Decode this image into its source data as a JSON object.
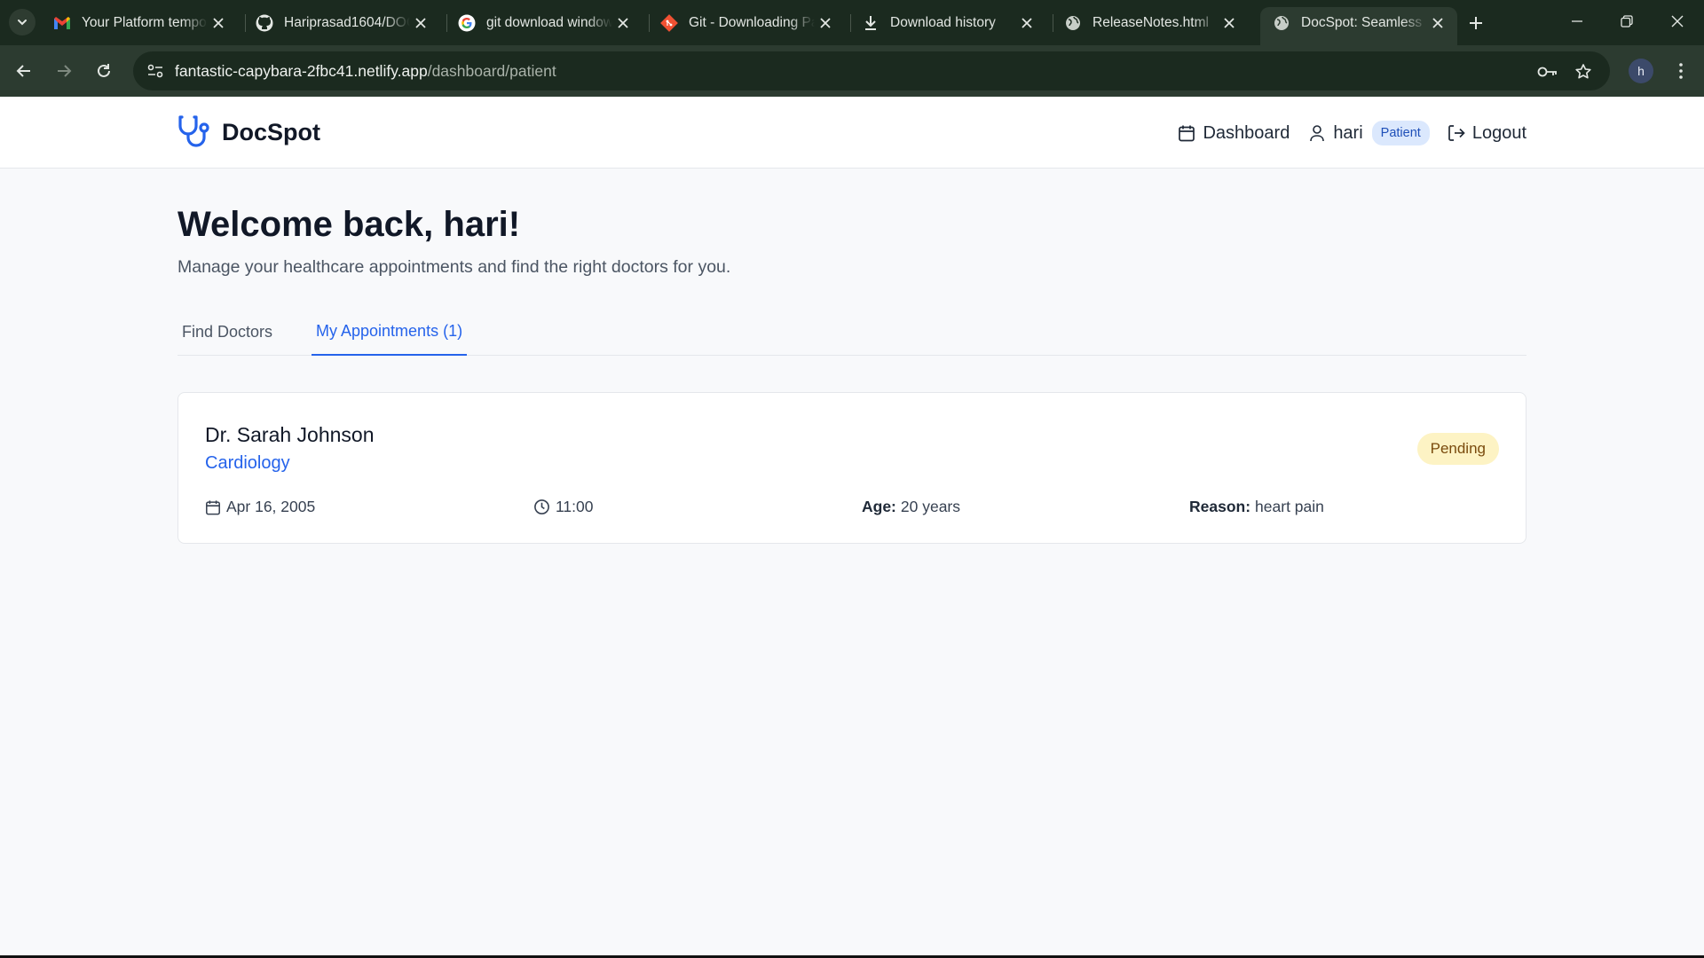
{
  "browser": {
    "tabs": [
      {
        "title": "Your Platform tempo",
        "icon": "gmail-icon"
      },
      {
        "title": "Hariprasad1604/DOC",
        "icon": "github-icon"
      },
      {
        "title": "git download window",
        "icon": "google-icon"
      },
      {
        "title": "Git - Downloading Pa",
        "icon": "git-icon"
      },
      {
        "title": "Download history",
        "icon": "download-icon"
      },
      {
        "title": "ReleaseNotes.html",
        "icon": "globe-icon"
      },
      {
        "title": "DocSpot: Seamless H",
        "icon": "globe-icon",
        "active": true
      }
    ],
    "url_host": "fantastic-capybara-2fbc41.netlify.app",
    "url_path": "/dashboard/patient",
    "profile_initial": "h"
  },
  "app": {
    "brand": "DocSpot",
    "nav": {
      "dashboard": "Dashboard",
      "user": "hari",
      "role": "Patient",
      "logout": "Logout"
    },
    "welcome": "Welcome back, hari!",
    "subtitle": "Manage your healthcare appointments and find the right doctors for you.",
    "tabs": [
      {
        "label": "Find Doctors",
        "active": false
      },
      {
        "label": "My Appointments (1)",
        "active": true
      }
    ],
    "appointment": {
      "doctor": "Dr. Sarah Johnson",
      "specialty": "Cardiology",
      "status": "Pending",
      "date": "Apr 16, 2005",
      "time": "11:00",
      "age_label": "Age:",
      "age_value": "20 years",
      "reason_label": "Reason:",
      "reason_value": "heart pain"
    }
  },
  "colors": {
    "accent": "#2563eb",
    "status_pending_bg": "#fdf3c4",
    "status_pending_text": "#7a4b0d",
    "browser_frame": "#1b2a1f"
  }
}
